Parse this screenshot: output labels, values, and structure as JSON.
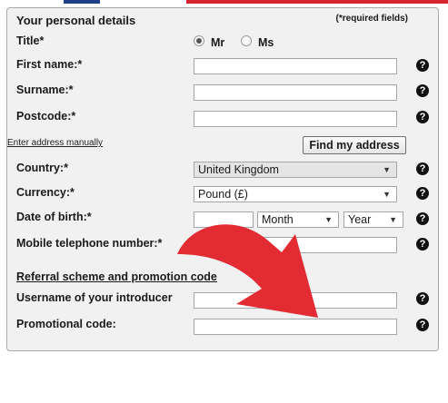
{
  "form": {
    "title": "Your personal details",
    "required_note": "(*required fields)",
    "title_label": "Title*",
    "title_options": [
      "Mr",
      "Ms"
    ],
    "title_selected": "Mr",
    "first_name_label": "First name:*",
    "surname_label": "Surname:*",
    "postcode_label": "Postcode:*",
    "enter_manual_link": "Enter address manually",
    "find_address_button": "Find my address",
    "country_label": "Country:*",
    "country_value": "United Kingdom",
    "currency_label": "Currency:*",
    "currency_value": "Pound (£)",
    "dob_label": "Date of birth:*",
    "dob_month": "Month",
    "dob_year": "Year",
    "mobile_label": "Mobile telephone number:*",
    "referral_heading": "Referral scheme and promotion code",
    "introducer_label": "Username of your introducer",
    "promo_label": "Promotional code:"
  },
  "help_icon_glyph": "?",
  "dropdown_glyph": "▼",
  "colors": {
    "panel_bg": "#f1f1f1",
    "arrow_red": "#e32b34",
    "top_red": "#d8242f",
    "top_blue": "#1f3f8a"
  }
}
